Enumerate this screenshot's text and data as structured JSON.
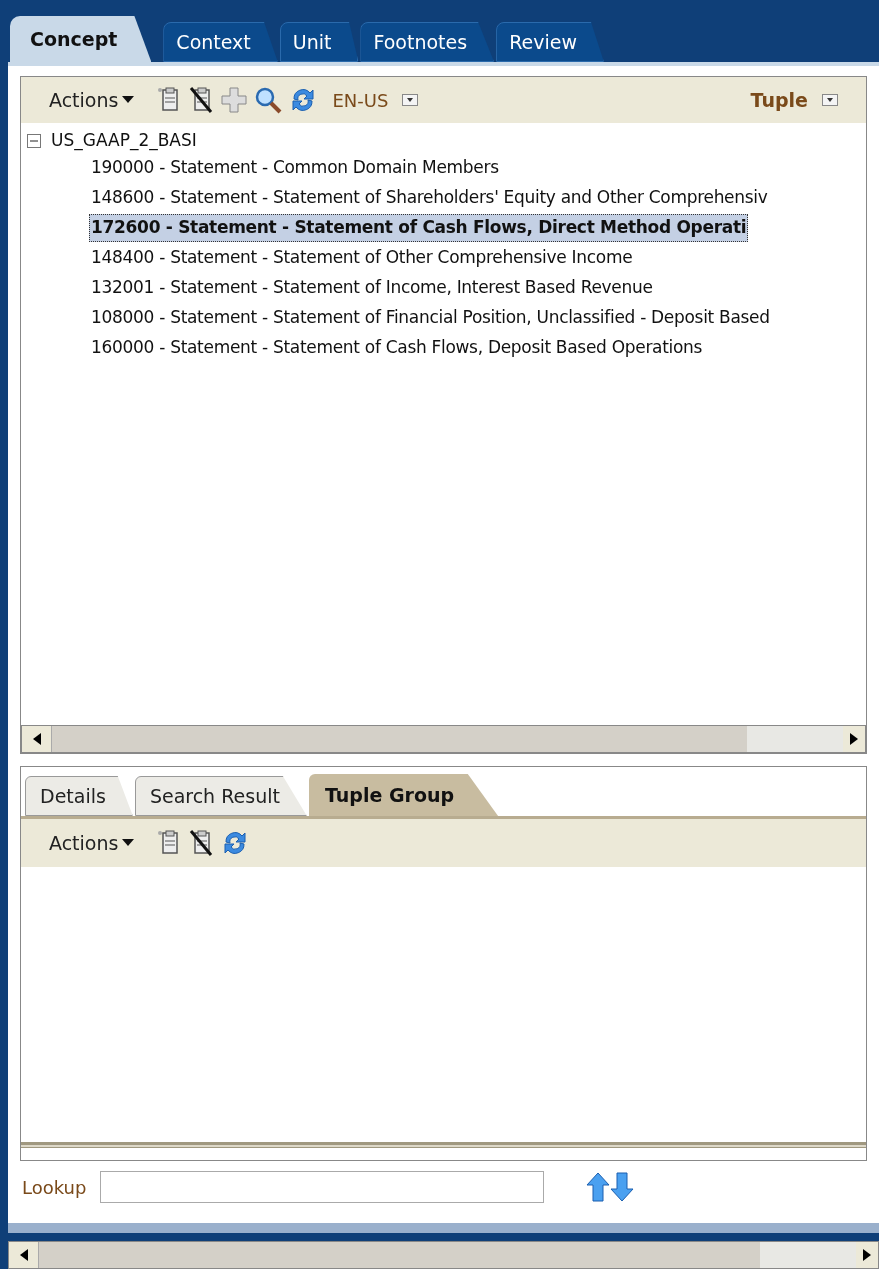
{
  "tabs": [
    {
      "label": "Concept",
      "selected": true
    },
    {
      "label": "Context",
      "selected": false
    },
    {
      "label": "Unit",
      "selected": false
    },
    {
      "label": "Footnotes",
      "selected": false
    },
    {
      "label": "Review",
      "selected": false
    }
  ],
  "toolbar": {
    "actions": "Actions",
    "language": "EN-US",
    "mode": "Tuple"
  },
  "tree": {
    "label": "US_GAAP_2_BASI",
    "expanded": true,
    "children": [
      {
        "label": "190000 - Statement - Common Domain Members",
        "selected": false
      },
      {
        "label": "148600 - Statement - Statement of Shareholders' Equity and Other Comprehensiv",
        "selected": false
      },
      {
        "label": "172600 - Statement - Statement of Cash Flows, Direct Method Operati",
        "selected": true
      },
      {
        "label": "148400 - Statement - Statement of Other Comprehensive Income",
        "selected": false
      },
      {
        "label": "132001 - Statement - Statement of Income, Interest Based Revenue",
        "selected": false
      },
      {
        "label": "108000 - Statement - Statement of Financial Position, Unclassified - Deposit Based",
        "selected": false
      },
      {
        "label": "160000 - Statement - Statement of Cash Flows, Deposit Based Operations",
        "selected": false
      }
    ]
  },
  "lower_tabs": [
    {
      "label": "Details",
      "selected": false
    },
    {
      "label": "Search Result",
      "selected": false
    },
    {
      "label": "Tuple Group",
      "selected": true
    }
  ],
  "lower_toolbar": {
    "actions": "Actions"
  },
  "lookup": {
    "label": "Lookup"
  }
}
